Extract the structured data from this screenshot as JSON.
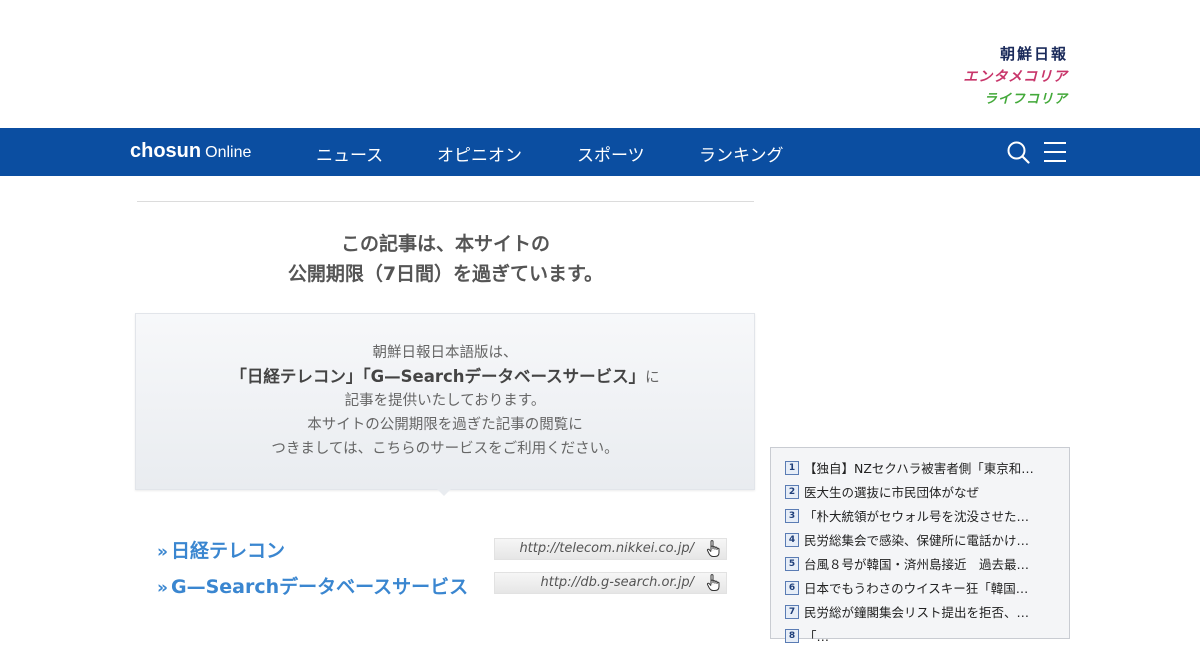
{
  "brands": [
    "朝鮮日報",
    "エンタメコリア",
    "ライフコリア"
  ],
  "nav": {
    "logo_bold": "chosun",
    "logo_light": "Online",
    "items": [
      "ニュース",
      "オピニオン",
      "スポーツ",
      "ランキング"
    ],
    "search_icon": "search-icon",
    "menu_icon": "hamburger-menu-icon"
  },
  "headline": {
    "line1": "この記事は、本サイトの",
    "line2": "公開期限（7日間）を過ぎています。"
  },
  "info": {
    "line1": "朝鮮日報日本語版は、",
    "line2_strong": "「日経テレコン」「G—Searchデータベースサービス」",
    "line2_suffix": "に",
    "line3": "記事を提供いたしております。",
    "line4": "本サイトの公開期限を過ぎた記事の閲覧に",
    "line5": "つきましては、こちらのサービスをご利用ください。"
  },
  "services": [
    {
      "name": "日経テレコン",
      "url": "http://telecom.nikkei.co.jp/"
    },
    {
      "name": "G—Searchデータベースサービス",
      "url": "http://db.g-search.or.jp/"
    }
  ],
  "ranking": [
    {
      "num": "1",
      "title": "【独自】NZセクハラ被害者側「東京和…"
    },
    {
      "num": "2",
      "title": "医大生の選抜に市民団体がなぜ"
    },
    {
      "num": "3",
      "title": "「朴大統領がセウォル号を沈没させた…"
    },
    {
      "num": "4",
      "title": "民労総集会で感染、保健所に電話かけ…"
    },
    {
      "num": "5",
      "title": "台風８号が韓国・済州島接近　過去最…"
    },
    {
      "num": "6",
      "title": "日本でもうわさのウイスキー狂「韓国…"
    },
    {
      "num": "7",
      "title": "民労総が鐘閣集会リスト提出を拒否、…"
    },
    {
      "num": "8",
      "title": "「…"
    }
  ],
  "colors": {
    "nav_bg": "#0b4ea1",
    "link": "#3a86d0",
    "brand_red": "#c8356a",
    "brand_green": "#43a93a"
  }
}
